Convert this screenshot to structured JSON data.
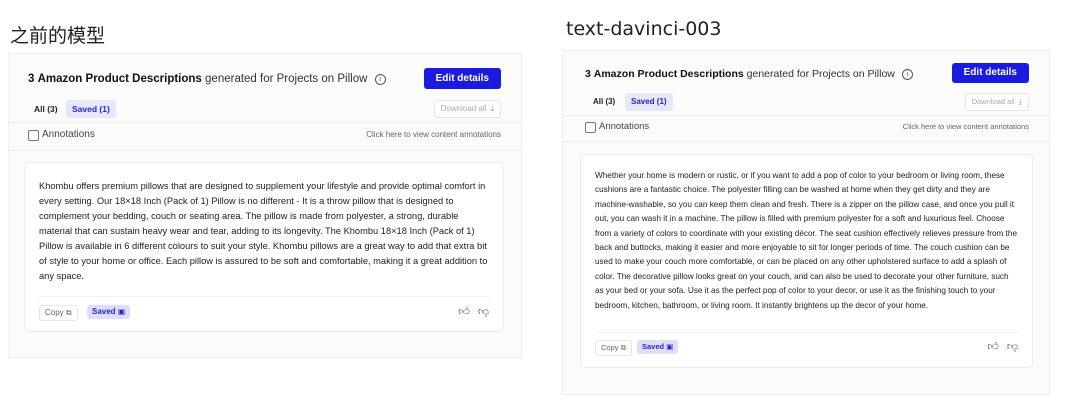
{
  "left": {
    "label": "之前的模型",
    "header": {
      "count": "3",
      "title_bold": "Amazon Product Descriptions",
      "title_rest": "generated for Projects on Pillow",
      "info_icon": "info-icon",
      "edit_label": "Edit details"
    },
    "tabs": [
      {
        "label": "All (3)"
      },
      {
        "label": "Saved (1)"
      }
    ],
    "download_label": "Download all",
    "annotations_label": "Annotations",
    "annotations_hint": "Click here to view content annotations",
    "content": "Khombu offers premium pillows that are designed to supplement your lifestyle and provide optimal comfort in every setting. Our 18×18 Inch (Pack of 1) Pillow is no different - It is a throw pillow that is designed to complement your bedding, couch or seating area. The pillow is made from polyester, a strong, durable material that can sustain heavy wear and tear, adding to its longevity. The Khombu 18×18 Inch (Pack of 1) Pillow is available in 6 different colours to suit your style. Khombu pillows are a great way to add that extra bit of style to your home or office. Each pillow is assured to be soft and comfortable, making it a great addition to any space.",
    "copy_label": "Copy",
    "saved_label": "Saved"
  },
  "right": {
    "label": "text-davinci-003",
    "header": {
      "count": "3",
      "title_bold": "Amazon Product Descriptions",
      "title_rest": "generated for Projects on Pillow",
      "info_icon": "info-icon",
      "edit_label": "Edit details"
    },
    "tabs": [
      {
        "label": "All (3)"
      },
      {
        "label": "Saved (1)"
      }
    ],
    "download_label": "Download all",
    "annotations_label": "Annotations",
    "annotations_hint": "Click here to view content annotations",
    "content": "Whether your home is modern or rustic, or if you want to add a pop of color to your bedroom or living room, these cushions are a fantastic choice. The polyester filling can be washed at home when they get dirty and they are machine-washable, so you can keep them clean and fresh. There is a zipper on the pillow case, and once you pull it out, you can wash it in a machine. The pillow is filled with premium polyester for a soft and luxurious feel. Choose from a variety of colors to coordinate with your existing décor. The seat cushion effectively relieves pressure from the back and buttocks, making it easier and more enjoyable to sit for longer periods of time. The couch cushion can be used to make your couch more comfortable, or can be placed on any other upholstered surface to add a splash of color. The decorative pillow looks great on your couch, and can also be used to decorate your other furniture, such as your bed or your sofa. Use it as the perfect pop of color to your decor, or use it as the finishing touch to your bedroom, kitchen, bathroom, or living room. It instantly brightens up the decor of your home.",
    "copy_label": "Copy",
    "saved_label": "Saved"
  },
  "colors": {
    "accent": "#1a1ae0",
    "saved_bg": "#dedefa",
    "saved_text": "#2626c9"
  }
}
